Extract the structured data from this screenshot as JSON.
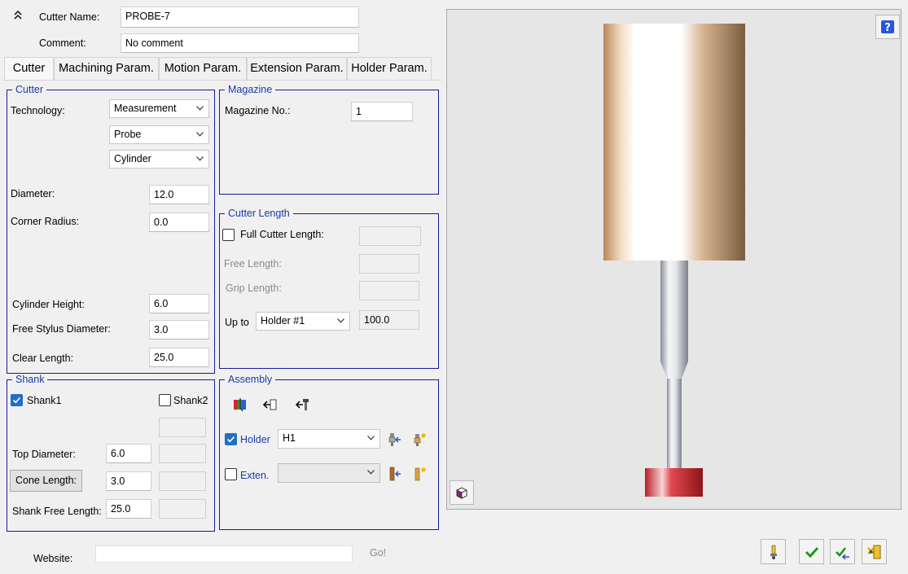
{
  "header": {
    "cutter_name_label": "Cutter Name:",
    "cutter_name_value": "PROBE-7",
    "comment_label": "Comment:",
    "comment_value": "No comment"
  },
  "tabs": [
    {
      "label": "Cutter",
      "active": true
    },
    {
      "label": "Machining Param.",
      "active": false
    },
    {
      "label": "Motion Param.",
      "active": false
    },
    {
      "label": "Extension Param.",
      "active": false
    },
    {
      "label": "Holder Param.",
      "active": false
    }
  ],
  "cutter": {
    "title": "Cutter",
    "technology_label": "Technology:",
    "technology_value": "Measurement",
    "type_value": "Probe",
    "shape_value": "Cylinder",
    "diameter_label": "Diameter:",
    "diameter_value": "12.0",
    "corner_radius_label": "Corner Radius:",
    "corner_radius_value": "0.0",
    "cylinder_height_label": "Cylinder Height:",
    "cylinder_height_value": "6.0",
    "free_stylus_label": "Free Stylus Diameter:",
    "free_stylus_value": "3.0",
    "clear_length_label": "Clear Length:",
    "clear_length_value": "25.0"
  },
  "magazine": {
    "title": "Magazine",
    "magazine_no_label": "Magazine No.:",
    "magazine_no_value": "1"
  },
  "cutter_length": {
    "title": "Cutter Length",
    "full_label": "Full Cutter Length:",
    "free_label": "Free Length:",
    "grip_label": "Grip Length:",
    "up_to_label": "Up to",
    "up_to_value": "Holder #1",
    "up_to_length": "100.0"
  },
  "shank": {
    "title": "Shank",
    "shank1_label": "Shank1",
    "shank2_label": "Shank2",
    "top_diameter_label": "Top Diameter:",
    "top_diameter_value": "6.0",
    "cone_length_label": "Cone Length:",
    "cone_length_value": "3.0",
    "free_length_label": "Shank Free Length:",
    "free_length_value": "25.0"
  },
  "assembly": {
    "title": "Assembly",
    "holder_label": "Holder",
    "holder_value": "H1",
    "exten_label": "Exten.",
    "exten_value": ""
  },
  "footer": {
    "website_label": "Website:",
    "website_value": "",
    "go_label": "Go!"
  },
  "colors": {
    "group_border": "#1a1a9a",
    "legend_text": "#1a3aa8",
    "checkbox_on": "#1f6fc6",
    "probe_tip": "#c8242a"
  }
}
